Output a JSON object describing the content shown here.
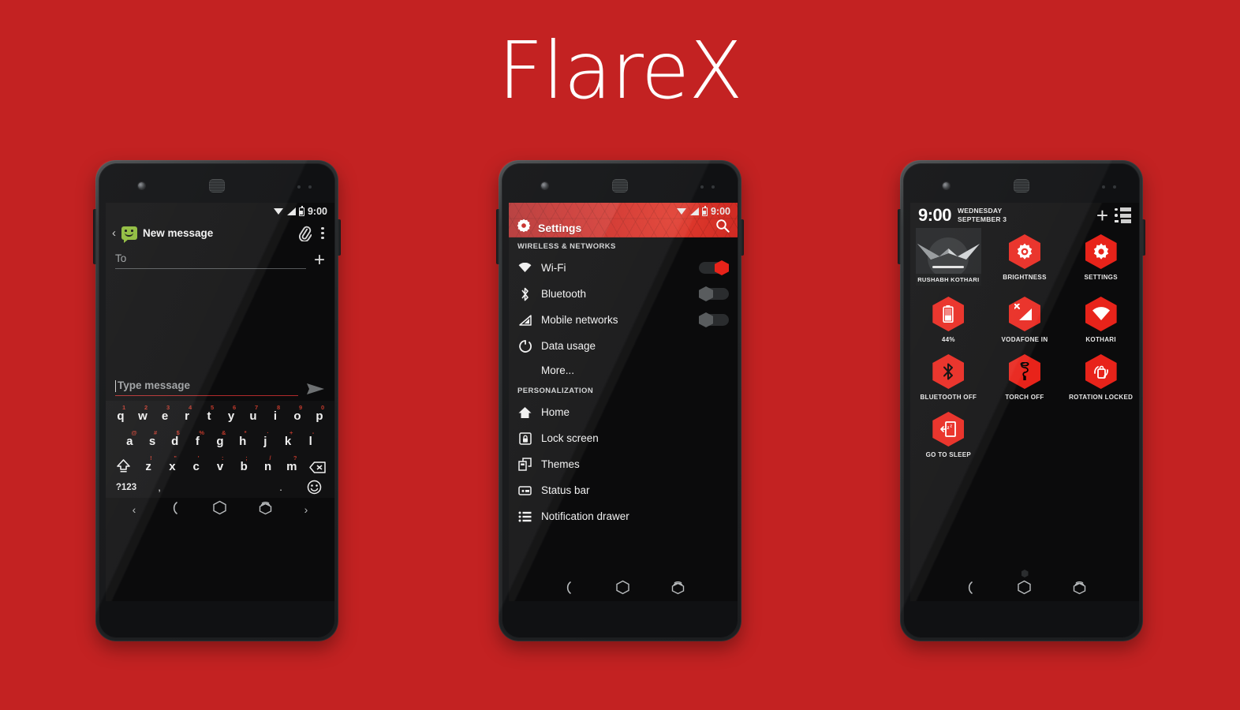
{
  "page": {
    "title": "FlareX",
    "background_color": "#c32222",
    "accent_color": "#e8231a"
  },
  "phone1": {
    "name": "messaging-app",
    "statusbar": {
      "time": "9:00",
      "icons": [
        "wifi-icon",
        "signal-icon",
        "battery-icon"
      ]
    },
    "appbar": {
      "back_label": "‹",
      "app_icon": "messaging-icon",
      "title": "New message",
      "attach_icon": "paperclip-icon",
      "overflow_icon": "more-vert-icon"
    },
    "recipient": {
      "placeholder": "To",
      "value": "",
      "add_label": "+"
    },
    "compose": {
      "placeholder": "Type message",
      "value": "",
      "send_icon": "send-icon"
    },
    "keyboard": {
      "row1": [
        {
          "key": "q",
          "sup": "1"
        },
        {
          "key": "w",
          "sup": "2"
        },
        {
          "key": "e",
          "sup": "3"
        },
        {
          "key": "r",
          "sup": "4"
        },
        {
          "key": "t",
          "sup": "5"
        },
        {
          "key": "y",
          "sup": "6"
        },
        {
          "key": "u",
          "sup": "7"
        },
        {
          "key": "i",
          "sup": "8"
        },
        {
          "key": "o",
          "sup": "9"
        },
        {
          "key": "p",
          "sup": "0"
        }
      ],
      "row2": [
        {
          "key": "a",
          "sup": "@"
        },
        {
          "key": "s",
          "sup": "#"
        },
        {
          "key": "d",
          "sup": "$"
        },
        {
          "key": "f",
          "sup": "%"
        },
        {
          "key": "g",
          "sup": "&"
        },
        {
          "key": "h",
          "sup": "*"
        },
        {
          "key": "j",
          "sup": "·"
        },
        {
          "key": "k",
          "sup": "+"
        },
        {
          "key": "l",
          "sup": "-"
        }
      ],
      "row3": [
        {
          "key": "z",
          "sup": "!"
        },
        {
          "key": "x",
          "sup": "\""
        },
        {
          "key": "c",
          "sup": "'"
        },
        {
          "key": "v",
          "sup": ":"
        },
        {
          "key": "b",
          "sup": ";"
        },
        {
          "key": "n",
          "sup": "/"
        },
        {
          "key": "m",
          "sup": "?"
        }
      ],
      "shift_icon": "shift-icon",
      "delete_icon": "backspace-icon",
      "symbols_label": "?123",
      "comma_label": ",",
      "period_label": ".",
      "emoji_icon": "emoji-icon"
    },
    "navbar": {
      "left_label": "‹",
      "back_icon": "back-icon",
      "home_icon": "home-hex-icon",
      "recents_icon": "recents-hex-icon",
      "right_label": "›"
    }
  },
  "phone2": {
    "name": "settings-app",
    "statusbar": {
      "time": "9:00",
      "icons": [
        "wifi-icon",
        "signal-icon",
        "battery-icon"
      ]
    },
    "header": {
      "gear_icon": "gear-icon",
      "title": "Settings",
      "search_icon": "search-icon"
    },
    "sections": [
      {
        "header": "WIRELESS & NETWORKS",
        "items": [
          {
            "icon": "wifi-icon",
            "label": "Wi-Fi",
            "toggle": "on"
          },
          {
            "icon": "bluetooth-icon",
            "label": "Bluetooth",
            "toggle": "off"
          },
          {
            "icon": "signal-icon",
            "label": "Mobile networks",
            "toggle": "off"
          },
          {
            "icon": "data-usage-icon",
            "label": "Data usage",
            "toggle": null
          },
          {
            "icon": null,
            "label": "More...",
            "toggle": null
          }
        ]
      },
      {
        "header": "PERSONALIZATION",
        "items": [
          {
            "icon": "home-icon",
            "label": "Home",
            "toggle": null
          },
          {
            "icon": "lock-screen-icon",
            "label": "Lock screen",
            "toggle": null
          },
          {
            "icon": "themes-icon",
            "label": "Themes",
            "toggle": null
          },
          {
            "icon": "status-bar-icon",
            "label": "Status bar",
            "toggle": null
          },
          {
            "icon": "notification-drawer-icon",
            "label": "Notification drawer",
            "toggle": null
          }
        ]
      }
    ],
    "navbar": {
      "back_icon": "back-icon",
      "home_icon": "home-hex-icon",
      "recents_icon": "recents-hex-icon"
    }
  },
  "phone3": {
    "name": "quick-settings-panel",
    "header": {
      "time": "9:00",
      "day": "WEDNESDAY",
      "date": "SEPTEMBER 3",
      "add_label": "+",
      "list_icon": "notification-list-icon"
    },
    "user": {
      "name": "RUSHABH KOTHARI",
      "avatar_icon": "user-avatar-icon"
    },
    "tiles": [
      {
        "icon": "brightness-icon",
        "label": "BRIGHTNESS"
      },
      {
        "icon": "settings-gear-icon",
        "label": "SETTINGS"
      },
      {
        "icon": "battery-icon",
        "label": "44%"
      },
      {
        "icon": "mobile-signal-off-icon",
        "label": "VODAFONE IN"
      },
      {
        "icon": "wifi-icon",
        "label": "KOTHARI"
      },
      {
        "icon": "bluetooth-icon",
        "label": "BLUETOOTH OFF"
      },
      {
        "icon": "torch-icon",
        "label": "TORCH OFF"
      },
      {
        "icon": "rotation-lock-icon",
        "label": "ROTATION LOCKED"
      },
      {
        "icon": "sleep-icon",
        "label": "GO TO SLEEP"
      }
    ],
    "navbar": {
      "back_icon": "back-icon",
      "home_icon": "home-hex-icon",
      "recents_icon": "recents-hex-icon"
    }
  }
}
